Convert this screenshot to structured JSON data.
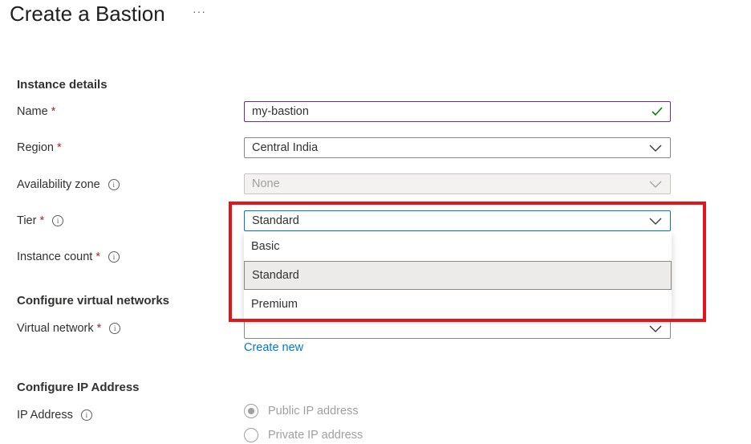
{
  "header": {
    "title": "Create a Bastion",
    "more": "···"
  },
  "sections": {
    "instance": "Instance details",
    "vnet": "Configure virtual networks",
    "ip": "Configure IP Address"
  },
  "fields": {
    "name": {
      "label": "Name",
      "required": "*",
      "value": "my-bastion"
    },
    "region": {
      "label": "Region",
      "required": "*",
      "value": "Central India"
    },
    "zone": {
      "label": "Availability zone",
      "value": "None"
    },
    "tier": {
      "label": "Tier",
      "required": "*",
      "value": "Standard"
    },
    "instance_count": {
      "label": "Instance count",
      "required": "*"
    },
    "vnet": {
      "label": "Virtual network",
      "required": "*",
      "value": ""
    },
    "ip": {
      "label": "IP Address"
    }
  },
  "tier_options": [
    "Basic",
    "Standard",
    "Premium"
  ],
  "tier_selected": "Standard",
  "links": {
    "create_new": "Create new"
  },
  "ip_options": [
    {
      "label": "Public IP address",
      "checked": true
    },
    {
      "label": "Private IP address",
      "checked": false
    }
  ],
  "colors": {
    "accent": "#0078d4",
    "highlight": "#e3151a",
    "valid": "#107c10",
    "required": "#a4262c"
  },
  "icons": {
    "info": "info-icon",
    "chevron": "chevron-down-icon",
    "check": "checkmark-icon"
  }
}
